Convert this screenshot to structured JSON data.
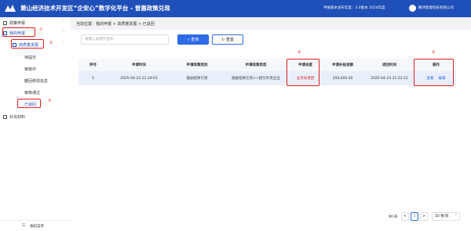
{
  "header": {
    "title": "萧山经济技术开发区“企安心”数字化平台 - 普惠政策兑现",
    "version_text": "申报版本发布年度：3.0版本 2024年度",
    "company": "拥鸿智能科技有限公司"
  },
  "sidebar": {
    "policy_apply": "政策申报",
    "my_apply": "我的申报",
    "hq_policy": "高质量发展",
    "items": [
      "待提交",
      "审核中",
      "撤回修改信息",
      "审核通过",
      "已退回"
    ],
    "supplement": "补充材料",
    "collapse": "收起菜单",
    "markers": [
      "①",
      "②",
      "③"
    ]
  },
  "breadcrumb": "当前位置：我的申报 > 高质量发展 > 已退回",
  "search": {
    "placeholder": "请输入关键字查询",
    "query_label": "查询",
    "reset_label": "重置"
  },
  "table": {
    "headers": [
      "序号",
      "申请时间",
      "申请政策类别",
      "申请政策类型",
      "申请进度",
      "申请补贴金额",
      "退回时间",
      "操作"
    ],
    "rows": [
      {
        "index": "1",
        "apply_time": "2025-04-24 21:19:01",
        "category": "鼓励招商引资",
        "type": "鼓励招商引资>>招引外资企业",
        "status": "业务局退回",
        "amount": "200,000.00",
        "return_time": "2025-04-24 21:22:12",
        "view_label": "查看",
        "edit_label": "编辑"
      }
    ],
    "markers": [
      "④",
      "⑤"
    ]
  },
  "pagination": {
    "total": "共1条",
    "prev": "<",
    "page": "1",
    "next": ">",
    "page_size": "10 条/页"
  },
  "colors": {
    "brand": "#1f4fb8",
    "accent": "#2e6be6",
    "highlight": "#e02020"
  }
}
